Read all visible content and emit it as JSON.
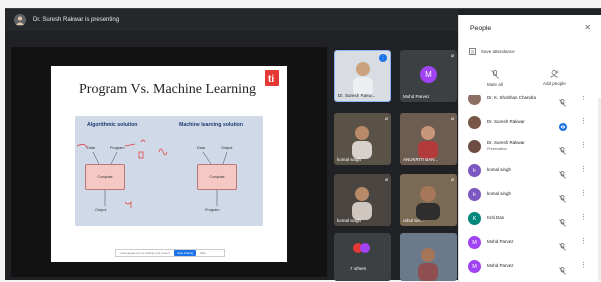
{
  "topbar": {
    "presenting_text": "Dr. Suresh Rakwar is presenting"
  },
  "slide": {
    "title": "Program Vs. Machine Learning",
    "logo_text": "ti",
    "heading_left": "Algorithmic solution",
    "heading_right": "Machine learning solution",
    "left": {
      "data": "Data",
      "program": "Program",
      "computer": "Computer",
      "output": "Output"
    },
    "right": {
      "data": "Data",
      "output": "Output",
      "computer": "Computer",
      "program": "Program"
    },
    "share_bar": {
      "text": "meet.google.com is sharing your screen.",
      "button": "Stop sharing",
      "hide": "Hide"
    }
  },
  "tiles": [
    {
      "name": "Dr. Suresh Rakw...",
      "type": "video"
    },
    {
      "name": "Mohd Parvez",
      "type": "avatar",
      "initial": "M",
      "color": "#a142f4"
    },
    {
      "name": "komal singh",
      "type": "video"
    },
    {
      "name": "ANUKRITI BAN...",
      "type": "video"
    },
    {
      "name": "komal singh",
      "type": "video"
    },
    {
      "name": "rahul sin...",
      "type": "video"
    },
    {
      "name": "7 others",
      "type": "others"
    },
    {
      "name": "",
      "type": "video"
    }
  ],
  "panel": {
    "title": "People",
    "save_attendance": "Save attendance",
    "mute_all": "Mute all",
    "add_people": "Add people",
    "participants": [
      {
        "name": "Dr. K. Shobhan Chandra",
        "sub": "",
        "initial": "",
        "color": "#8d6e63",
        "photo": true
      },
      {
        "name": "Dr. Suresh Rakwar",
        "sub": "",
        "initial": "",
        "color": "#795548",
        "photo": true,
        "active": true
      },
      {
        "name": "Dr. Suresh Rakwar",
        "sub": "Presentation",
        "initial": "",
        "color": "#6d4c41",
        "photo": true
      },
      {
        "name": "komal singh",
        "sub": "",
        "initial": "k",
        "color": "#7e57c2",
        "photo": false
      },
      {
        "name": "komal singh",
        "sub": "",
        "initial": "k",
        "color": "#7e57c2",
        "photo": false
      },
      {
        "name": "Kriti Das",
        "sub": "",
        "initial": "K",
        "color": "#00897b",
        "photo": false
      },
      {
        "name": "Mohd Parvez",
        "sub": "",
        "initial": "M",
        "color": "#a142f4",
        "photo": false
      },
      {
        "name": "Mohd Parvez",
        "sub": "",
        "initial": "M",
        "color": "#a142f4",
        "photo": false
      }
    ]
  }
}
